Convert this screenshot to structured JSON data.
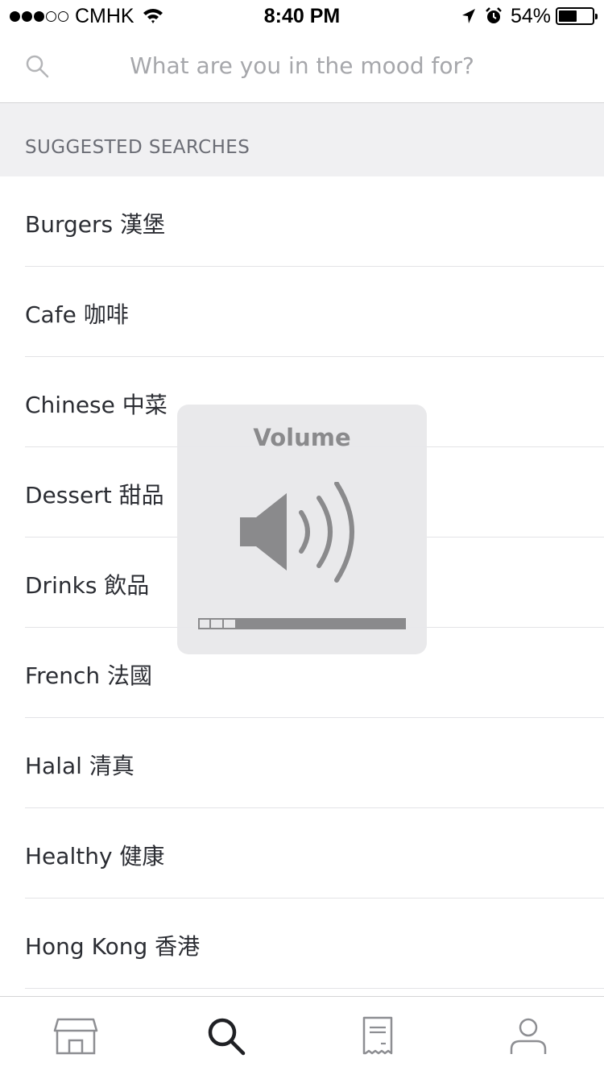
{
  "status_bar": {
    "carrier": "CMHK",
    "signal_bars_filled": 3,
    "signal_bars_total": 5,
    "time": "8:40 PM",
    "battery_percent": "54%",
    "battery_level": 0.54
  },
  "search": {
    "placeholder": "What are you in the mood for?",
    "value": ""
  },
  "suggested": {
    "header": "SUGGESTED SEARCHES",
    "items": [
      {
        "label": "Burgers 漢堡"
      },
      {
        "label": "Cafe 咖啡"
      },
      {
        "label": "Chinese 中菜"
      },
      {
        "label": "Dessert 甜品"
      },
      {
        "label": "Drinks 飲品"
      },
      {
        "label": "French 法國"
      },
      {
        "label": "Halal 清真"
      },
      {
        "label": "Healthy 健康"
      },
      {
        "label": "Hong Kong 香港"
      }
    ]
  },
  "volume_hud": {
    "title": "Volume",
    "level": 0.19
  },
  "tab_bar": {
    "tabs": [
      {
        "icon": "store-icon",
        "active": false
      },
      {
        "icon": "search-icon",
        "active": true
      },
      {
        "icon": "receipt-icon",
        "active": false
      },
      {
        "icon": "person-icon",
        "active": false
      }
    ]
  },
  "colors": {
    "text": "#2b2d33",
    "muted": "#6b6d75",
    "placeholder": "#a6a7ab",
    "section_bg": "#f0f0f2",
    "divider": "#e3e3e6",
    "tab_inactive": "#8d8e92",
    "tab_active": "#1f2024"
  }
}
